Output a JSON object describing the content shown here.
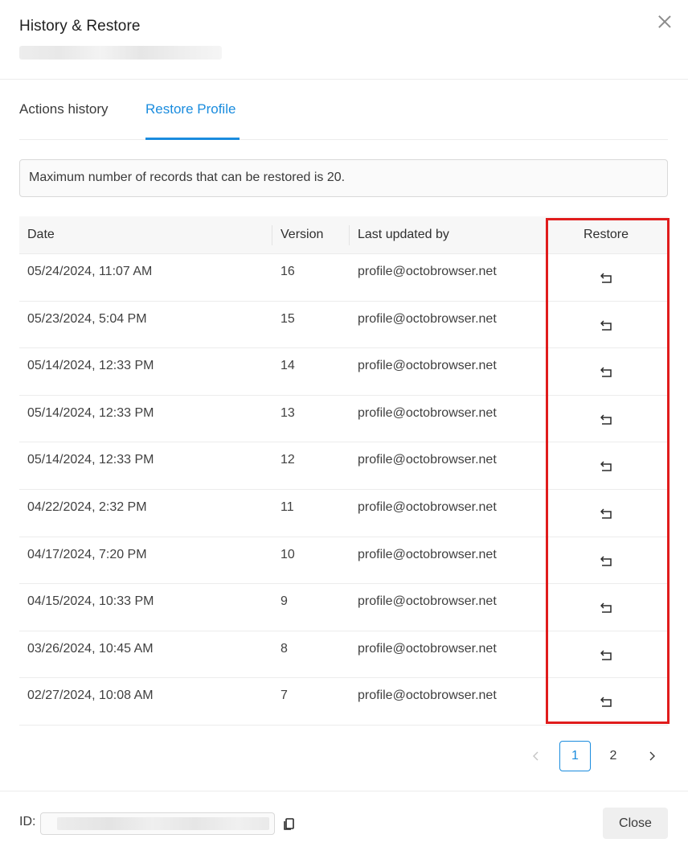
{
  "dialog": {
    "title": "History & Restore",
    "close_icon": "close-icon"
  },
  "tabs": [
    {
      "label": "Actions history",
      "active": false
    },
    {
      "label": "Restore Profile",
      "active": true
    }
  ],
  "info_text": "Maximum number of records that can be restored is 20.",
  "table": {
    "headers": {
      "date": "Date",
      "version": "Version",
      "updated_by": "Last updated by",
      "restore": "Restore"
    },
    "rows": [
      {
        "date": "05/24/2024, 11:07 AM",
        "version": "16",
        "updated_by": "profile@octobrowser.net"
      },
      {
        "date": "05/23/2024, 5:04 PM",
        "version": "15",
        "updated_by": "profile@octobrowser.net"
      },
      {
        "date": "05/14/2024, 12:33 PM",
        "version": "14",
        "updated_by": "profile@octobrowser.net"
      },
      {
        "date": "05/14/2024, 12:33 PM",
        "version": "13",
        "updated_by": "profile@octobrowser.net"
      },
      {
        "date": "05/14/2024, 12:33 PM",
        "version": "12",
        "updated_by": "profile@octobrowser.net"
      },
      {
        "date": "04/22/2024, 2:32 PM",
        "version": "11",
        "updated_by": "profile@octobrowser.net"
      },
      {
        "date": "04/17/2024, 7:20 PM",
        "version": "10",
        "updated_by": "profile@octobrowser.net"
      },
      {
        "date": "04/15/2024, 10:33 PM",
        "version": "9",
        "updated_by": "profile@octobrowser.net"
      },
      {
        "date": "03/26/2024, 10:45 AM",
        "version": "8",
        "updated_by": "profile@octobrowser.net"
      },
      {
        "date": "02/27/2024, 10:08 AM",
        "version": "7",
        "updated_by": "profile@octobrowser.net"
      }
    ]
  },
  "pagination": {
    "pages": [
      "1",
      "2"
    ],
    "current": "1"
  },
  "footer": {
    "id_label": "ID:",
    "close_label": "Close"
  },
  "colors": {
    "accent": "#1a8cde",
    "highlight": "#e01c1c"
  }
}
